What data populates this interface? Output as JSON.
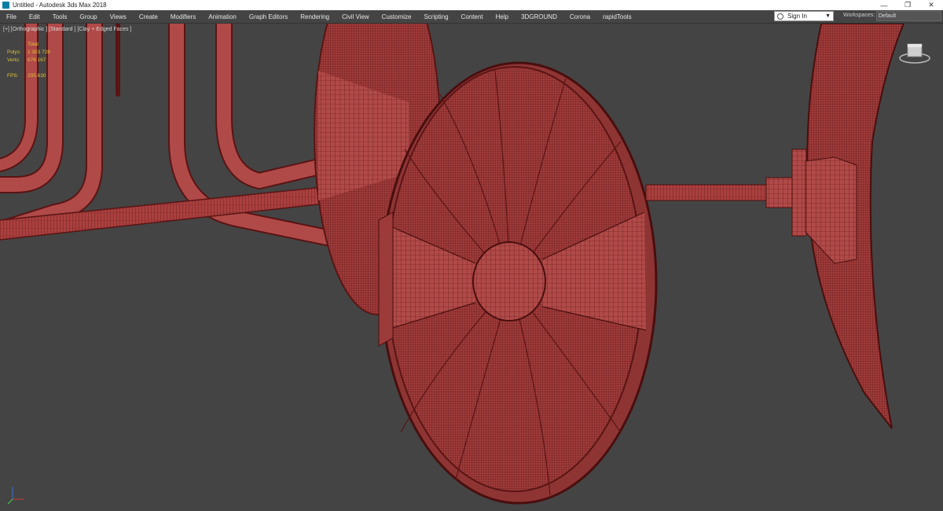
{
  "titlebar": {
    "title": "Untitled - Autodesk 3ds Max 2018"
  },
  "menus": [
    "File",
    "Edit",
    "Tools",
    "Group",
    "Views",
    "Create",
    "Modifiers",
    "Animation",
    "Graph Editors",
    "Rendering",
    "Civil View",
    "Customize",
    "Scripting",
    "Content",
    "Help",
    "3DGROUND",
    "Corona",
    "rapidTools"
  ],
  "account": {
    "signin": "Sign In"
  },
  "workspaces": {
    "label": "Workspaces:",
    "value": "Default"
  },
  "viewport": {
    "label": "[+] [Orthographic ] [Standard ] [Clay + Edged Faces ]",
    "stats": {
      "header": "Total",
      "polys_label": "Polys:",
      "polys": "1 303 728",
      "verts_label": "Verts:",
      "verts": "676 167",
      "fps_label": "FPS:",
      "fps": "205.630"
    }
  },
  "colors": {
    "mesh": "#b04a48",
    "wire": "#5a1414",
    "viewport_bg": "#444444",
    "stats": "#e2c230"
  }
}
